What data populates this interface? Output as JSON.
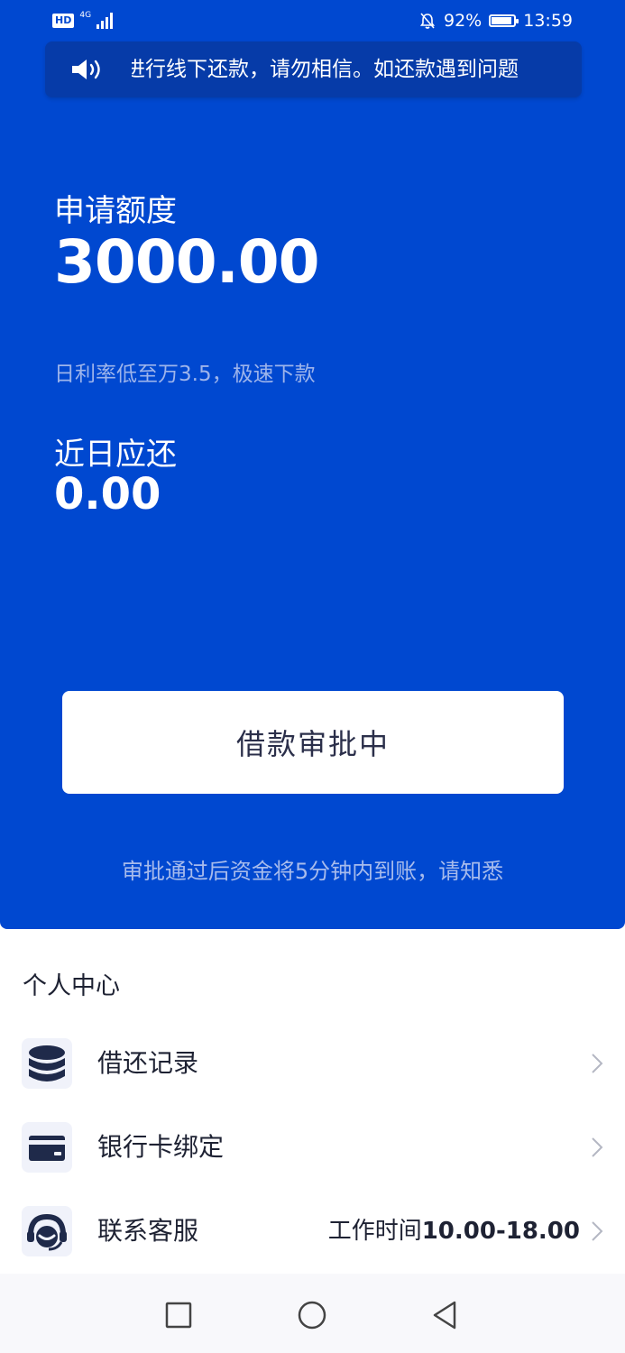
{
  "status_bar": {
    "hd": "HD",
    "network": "4G",
    "battery": "92%",
    "battery_level": 0.92,
    "time": "13:59"
  },
  "notice": {
    "text": "进行线下还款，请勿相信。如还款遇到问题"
  },
  "loan": {
    "quota_label": "申请额度",
    "quota_amount": "3000.00",
    "rate_text": "日利率低至万3.5，极速下款",
    "due_label": "近日应还",
    "due_amount": "0.00",
    "status_button": "借款审批中",
    "hint": "审批通过后资金将5分钟内到账，请知悉"
  },
  "personal_center": {
    "title": "个人中心",
    "items": [
      {
        "label": "借还记录",
        "icon": "database-stack-icon"
      },
      {
        "label": "银行卡绑定",
        "icon": "bank-card-icon"
      },
      {
        "label": "联系客服",
        "icon": "headset-icon",
        "hours_prefix": "工作时间",
        "hours_value": "10.00-18.00"
      }
    ]
  },
  "colors": {
    "primary": "#0048D0",
    "notice_bg": "#063BA8",
    "icon_dark": "#1F2A4A",
    "text_dark": "#1E2233"
  }
}
